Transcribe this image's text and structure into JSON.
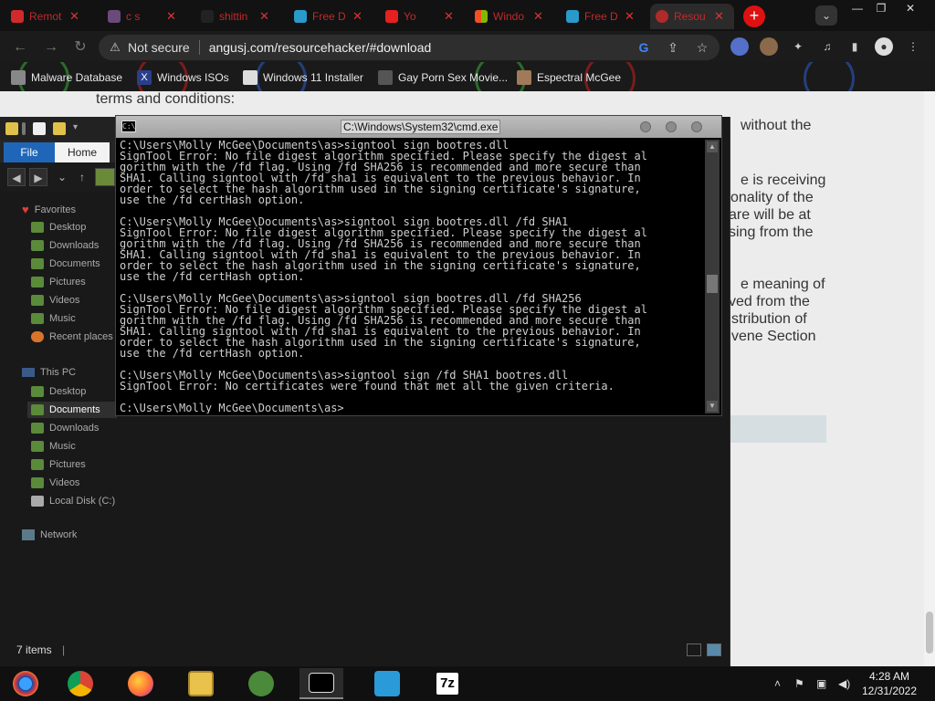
{
  "browser": {
    "tabs": [
      {
        "title": "Remot",
        "favicon_color": "#d12a2a"
      },
      {
        "title": "c s",
        "favicon_color": "#6a4a7a"
      },
      {
        "title": "shittin",
        "favicon_color": "#222222"
      },
      {
        "title": "Free D",
        "favicon_color": "#2a9ac9"
      },
      {
        "title": "Yo",
        "favicon_color": "#e52020"
      },
      {
        "title": "Windo",
        "favicon_color": "#2f7bd8"
      },
      {
        "title": "Free D",
        "favicon_color": "#2a9ac9"
      },
      {
        "title": "Resou",
        "favicon_color": "#b02a2a"
      }
    ],
    "new_tab_label": "+",
    "omnibox": {
      "security_label": "Not secure",
      "url": "angusj.com/resourcehacker/#download"
    },
    "bookmarks": [
      {
        "label": "Malware Database",
        "icon": "page-icon"
      },
      {
        "label": "Windows ISOs",
        "icon": "x-logo-icon"
      },
      {
        "label": "Windows 11 Installer",
        "icon": "page-icon"
      },
      {
        "label": "Gay Porn Sex Movie...",
        "icon": "site-icon"
      },
      {
        "label": "Espectral McGee",
        "icon": "bird-icon"
      }
    ]
  },
  "webpage": {
    "lines": [
      "terms and conditions:",
      "without the",
      "e is receiving",
      "onality of the",
      "are will be at",
      "sing from the",
      "e meaning of",
      "ved from the",
      "stribution of",
      "vene Section"
    ]
  },
  "explorer": {
    "ribbon": {
      "file": "File",
      "home": "Home"
    },
    "nav": {
      "favorites_header": "Favorites",
      "favorites": [
        "Desktop",
        "Downloads",
        "Documents",
        "Pictures",
        "Videos",
        "Music",
        "Recent places"
      ],
      "thispc_header": "This PC",
      "thispc": [
        "Desktop",
        "Documents",
        "Downloads",
        "Music",
        "Pictures",
        "Videos",
        "Local Disk (C:)"
      ],
      "network": "Network"
    },
    "status": "7 items"
  },
  "cmd": {
    "title": "C:\\Windows\\System32\\cmd.exe",
    "lines": [
      "C:\\Users\\Molly McGee\\Documents\\as>signtool sign bootres.dll",
      "SignTool Error: No file digest algorithm specified. Please specify the digest al",
      "gorithm with the /fd flag. Using /fd SHA256 is recommended and more secure than",
      "SHA1. Calling signtool with /fd sha1 is equivalent to the previous behavior. In",
      "order to select the hash algorithm used in the signing certificate's signature,",
      "use the /fd certHash option.",
      "",
      "C:\\Users\\Molly McGee\\Documents\\as>signtool sign bootres.dll /fd SHA1",
      "SignTool Error: No file digest algorithm specified. Please specify the digest al",
      "gorithm with the /fd flag. Using /fd SHA256 is recommended and more secure than",
      "SHA1. Calling signtool with /fd sha1 is equivalent to the previous behavior. In",
      "order to select the hash algorithm used in the signing certificate's signature,",
      "use the /fd certHash option.",
      "",
      "C:\\Users\\Molly McGee\\Documents\\as>signtool sign bootres.dll /fd SHA256",
      "SignTool Error: No file digest algorithm specified. Please specify the digest al",
      "gorithm with the /fd flag. Using /fd SHA256 is recommended and more secure than",
      "SHA1. Calling signtool with /fd sha1 is equivalent to the previous behavior. In",
      "order to select the hash algorithm used in the signing certificate's signature,",
      "use the /fd certHash option.",
      "",
      "C:\\Users\\Molly McGee\\Documents\\as>signtool sign /fd SHA1 bootres.dll",
      "SignTool Error: No certificates were found that met all the given criteria.",
      "",
      "C:\\Users\\Molly McGee\\Documents\\as>"
    ]
  },
  "taskbar": {
    "apps": [
      {
        "name": "start-button",
        "color": "#1e73d8"
      },
      {
        "name": "chrome-icon",
        "color": "#e4a52a"
      },
      {
        "name": "firefox-icon",
        "color": "#e8641c"
      },
      {
        "name": "file-explorer-icon",
        "color": "#e8c24a"
      },
      {
        "name": "network-app-icon",
        "color": "#5aaa4a"
      },
      {
        "name": "cmd-icon",
        "color": "#000000"
      },
      {
        "name": "remote-app-icon",
        "color": "#2a9ad8"
      },
      {
        "name": "7zip-icon",
        "color": "#ffffff"
      }
    ],
    "seven_zip_label": "7z",
    "time": "4:28 AM",
    "date": "12/31/2022"
  }
}
